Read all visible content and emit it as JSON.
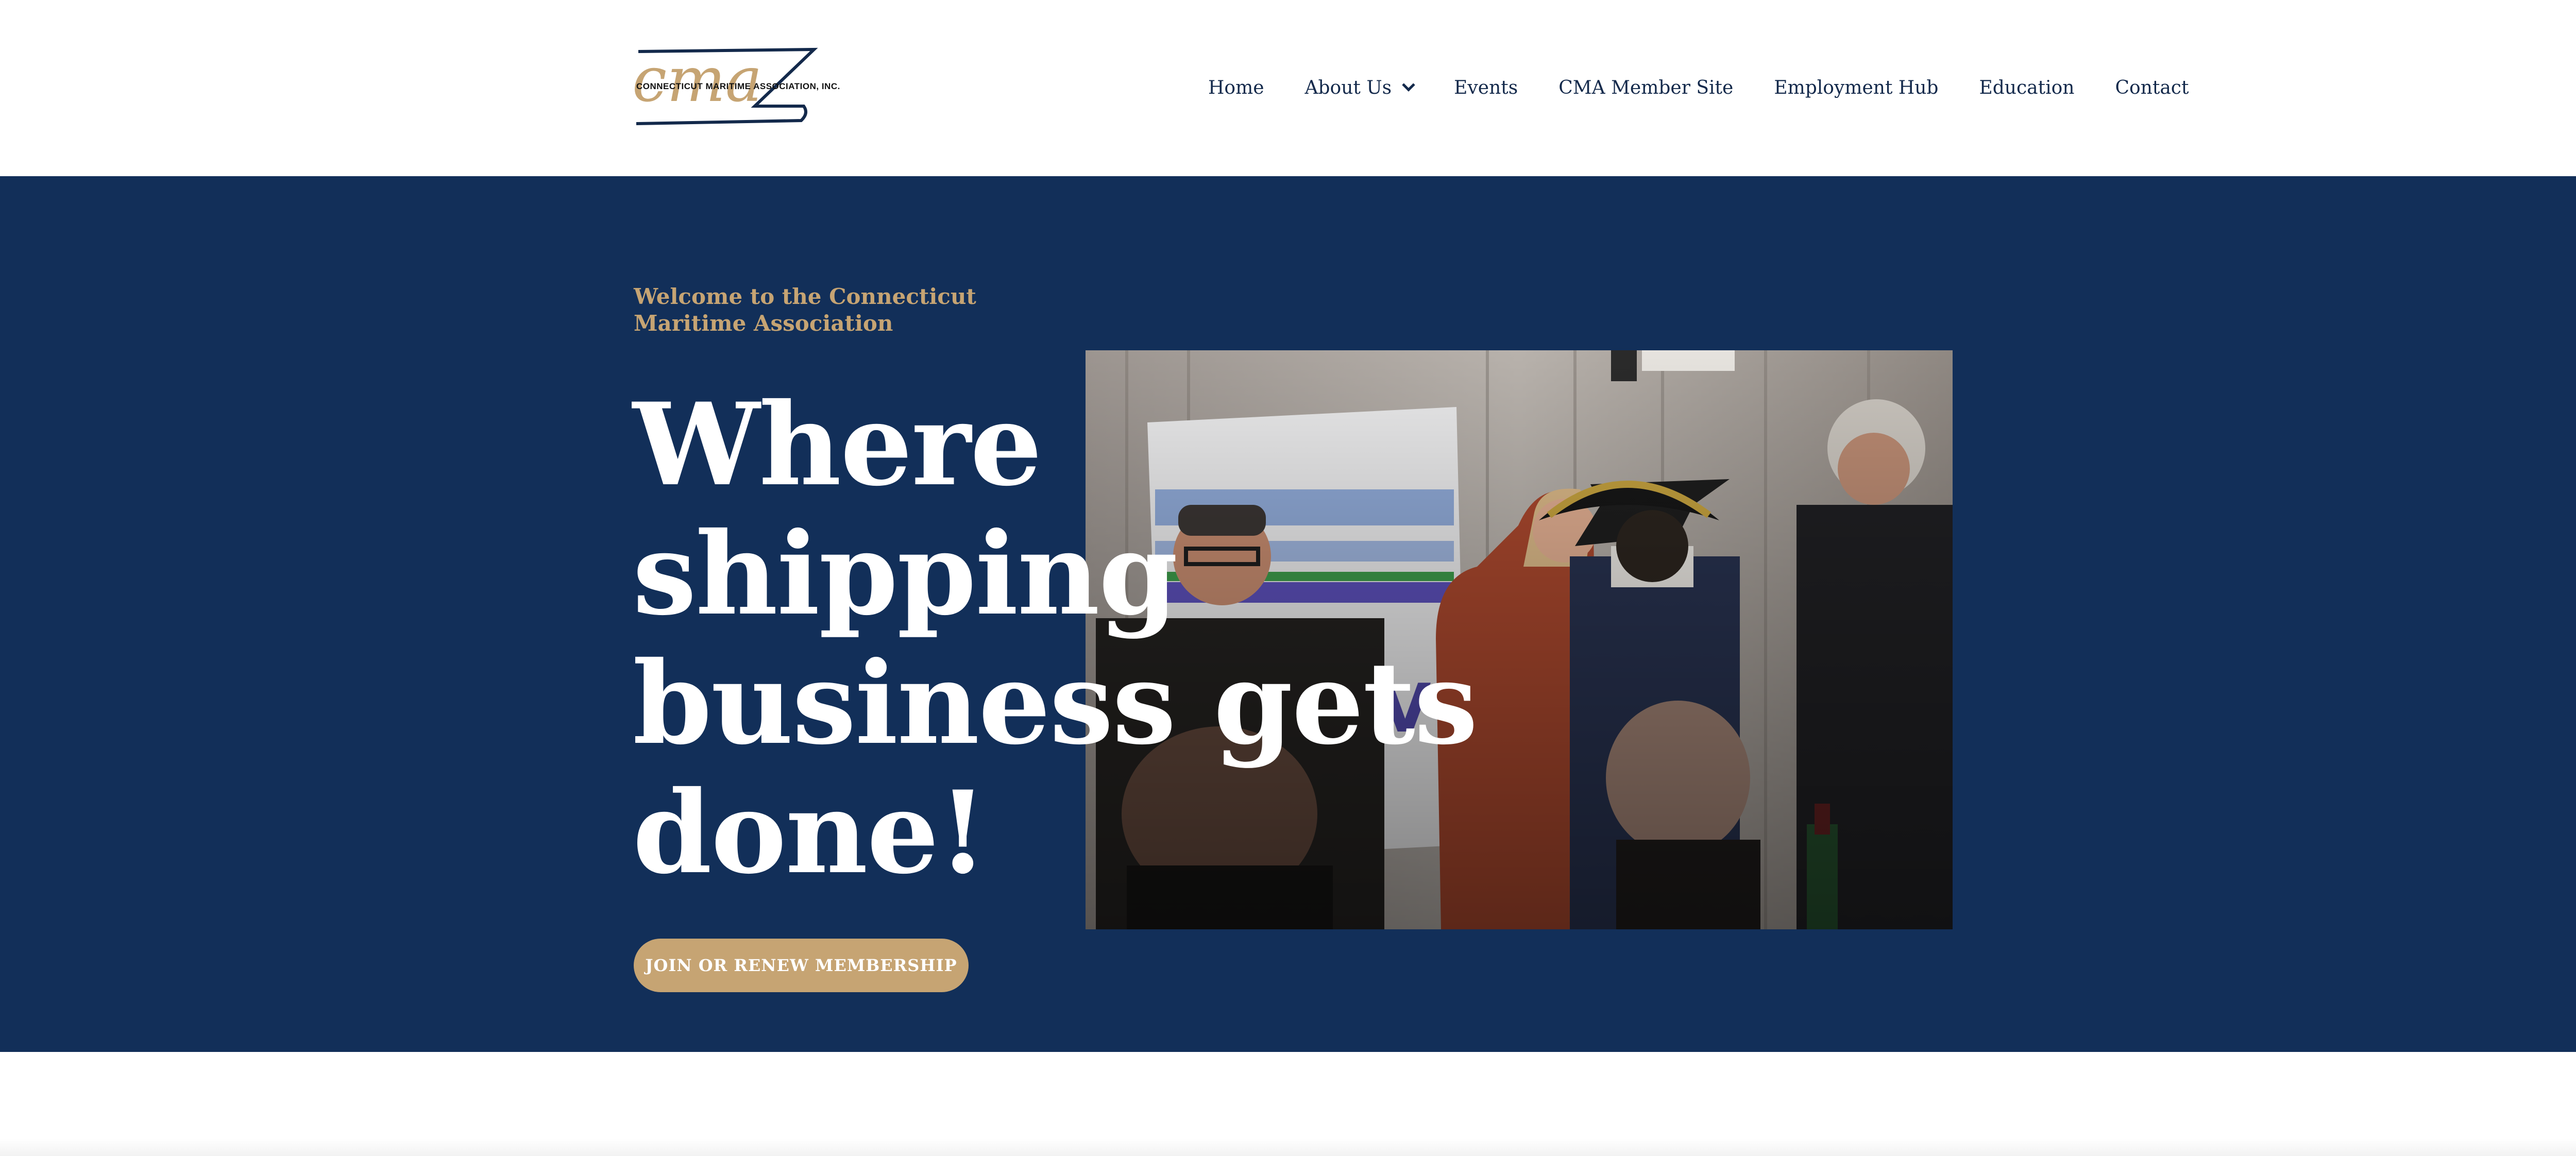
{
  "header": {
    "logo": {
      "script_text": "cma",
      "org_text": "CONNECTICUT MARITIME ASSOCIATION, INC."
    },
    "nav": [
      {
        "label": "Home"
      },
      {
        "label": "About Us",
        "icon": "chevron-down-icon"
      },
      {
        "label": "Events"
      },
      {
        "label": "CMA Member Site"
      },
      {
        "label": "Employment Hub"
      },
      {
        "label": "Education"
      },
      {
        "label": "Contact"
      }
    ]
  },
  "hero": {
    "welcome": "Welcome to the Connecticut Maritime Association",
    "headline_lines": [
      "Where",
      "shipping",
      "business gets",
      "done!"
    ],
    "cta_label": "JOIN OR RENEW MEMBERSHIP",
    "photo": "event-photo"
  },
  "colors": {
    "navy": "#122f59",
    "gold": "#c6a473",
    "nav_text": "#13294b",
    "white": "#ffffff"
  }
}
